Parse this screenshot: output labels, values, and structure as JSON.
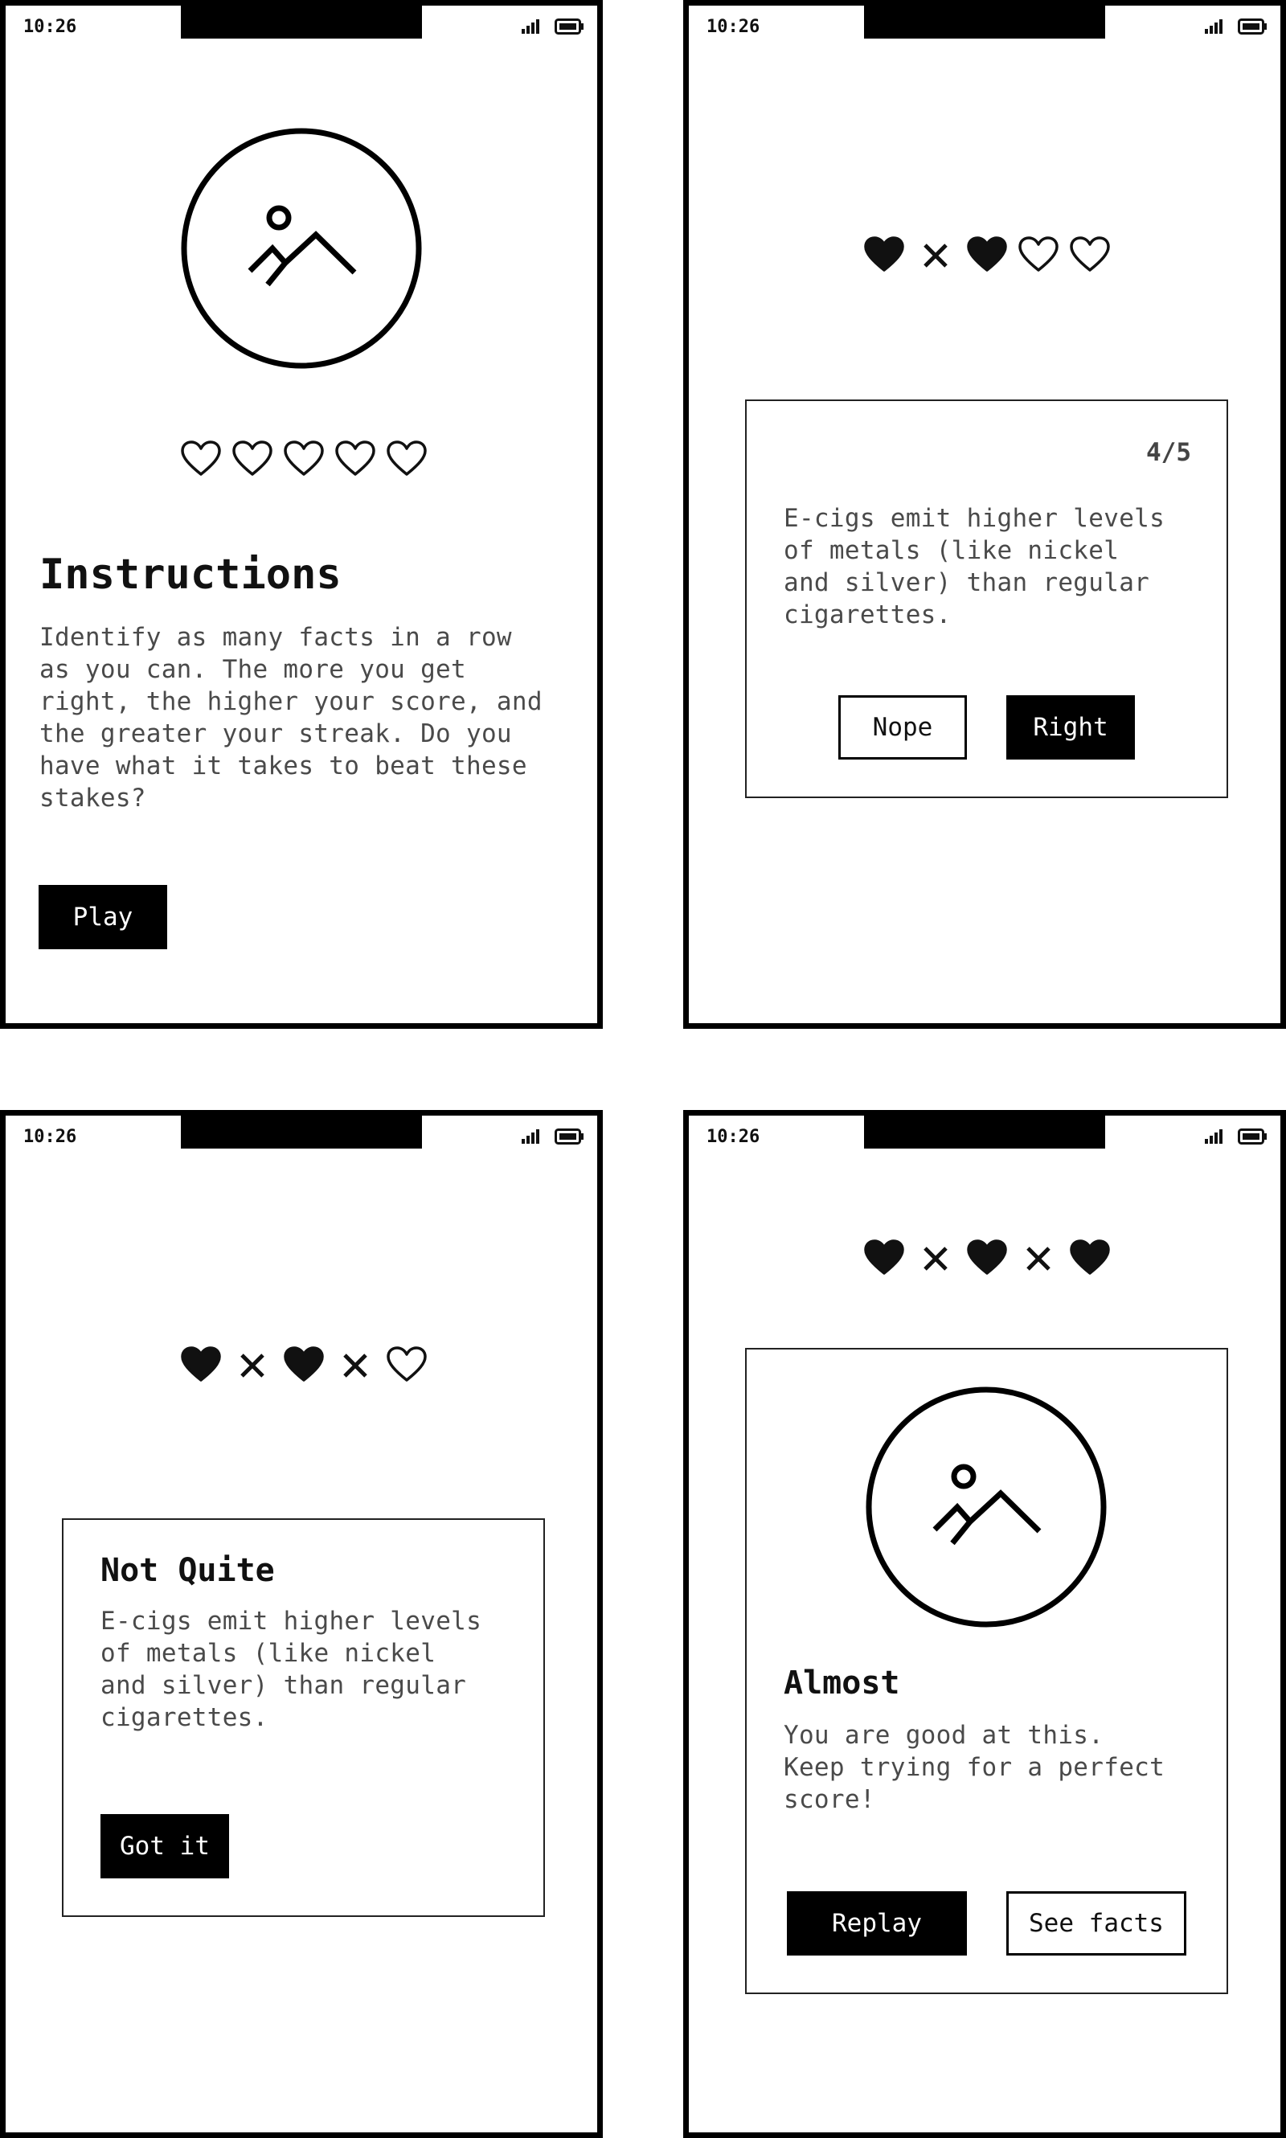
{
  "status": {
    "time": "10:26"
  },
  "screens": {
    "instructions": {
      "hearts": [
        "heart-outline",
        "heart-outline",
        "heart-outline",
        "heart-outline",
        "heart-outline"
      ],
      "title": "Instructions",
      "body": "Identify as many facts in a row\nas you can. The more you get\nright, the higher your score, and\nthe greater your streak. Do you\nhave what it takes to beat these\nstakes?",
      "play_label": "Play"
    },
    "question": {
      "hearts": [
        "heart-filled",
        "cross",
        "heart-filled",
        "heart-outline",
        "heart-outline"
      ],
      "counter": "4/5",
      "fact": "E-cigs emit higher levels\nof metals (like nickel\nand silver) than regular\ncigarettes.",
      "nope_label": "Nope",
      "right_label": "Right"
    },
    "feedback": {
      "hearts": [
        "heart-filled",
        "cross",
        "heart-filled",
        "cross",
        "heart-outline"
      ],
      "title": "Not Quite",
      "fact": "E-cigs emit higher levels\nof metals (like nickel\nand silver) than regular\ncigarettes.",
      "got_it_label": "Got it"
    },
    "result": {
      "hearts": [
        "heart-filled",
        "cross",
        "heart-filled",
        "cross",
        "heart-filled"
      ],
      "title": "Almost",
      "body": "You are good at this.\nKeep trying for a perfect\nscore!",
      "replay_label": "Replay",
      "see_facts_label": "See facts"
    }
  },
  "colors": {
    "ink": "#000000",
    "text": "#4a4a4a",
    "background": "#ffffff"
  }
}
